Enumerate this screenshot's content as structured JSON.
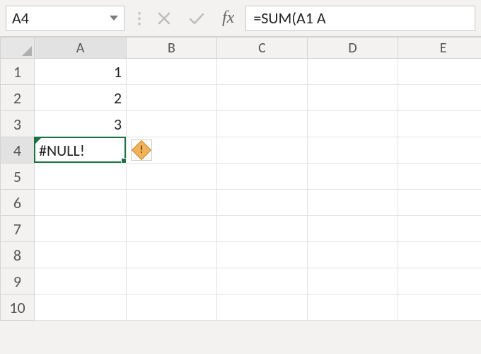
{
  "formulaBar": {
    "nameBox": "A4",
    "formula": "=SUM(A1 A"
  },
  "columns": [
    "A",
    "B",
    "C",
    "D",
    "E"
  ],
  "rowCount": 10,
  "activeCell": {
    "row": 4,
    "col": "A"
  },
  "cells": {
    "A1": {
      "display": "1",
      "align": "num"
    },
    "A2": {
      "display": "2",
      "align": "num"
    },
    "A3": {
      "display": "3",
      "align": "num"
    },
    "A4": {
      "display": "#NULL!",
      "align": "txt",
      "error": true
    }
  },
  "errorIndicator": {
    "glyph": "!"
  }
}
